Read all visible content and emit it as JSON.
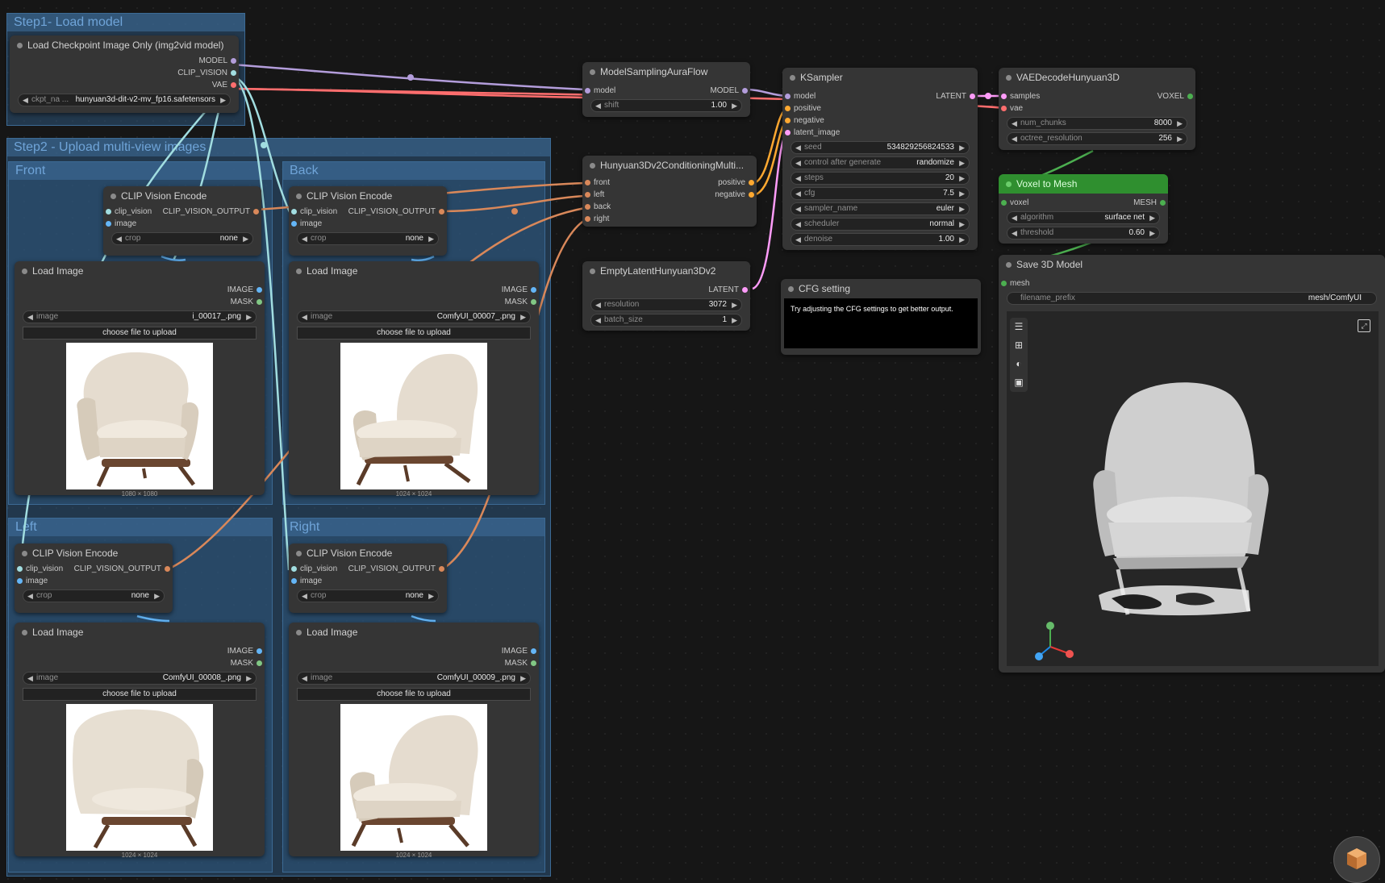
{
  "groups": {
    "step1": "Step1- Load model",
    "step2": "Step2 - Upload multi-view images",
    "front": "Front",
    "back": "Back",
    "left": "Left",
    "right": "Right"
  },
  "checkpoint": {
    "title": "Load Checkpoint Image Only (img2vid model)",
    "out_model": "MODEL",
    "out_clip_vision": "CLIP_VISION",
    "out_vae": "VAE",
    "ckpt_label": "ckpt_na ...",
    "ckpt_value": "hunyuan3d-dit-v2-mv_fp16.safetensors"
  },
  "clip_encode": {
    "title": "CLIP Vision Encode",
    "in_clip_vision": "clip_vision",
    "in_image": "image",
    "output": "CLIP_VISION_OUTPUT",
    "crop_label": "crop",
    "crop_value": "none"
  },
  "load_image": {
    "title": "Load Image",
    "out_image": "IMAGE",
    "out_mask": "MASK",
    "image_label": "image",
    "upload_label": "choose file to upload",
    "front_file": "i_00017_.png",
    "front_dim": "1080 × 1080",
    "back_file": "ComfyUI_00007_.png",
    "back_dim": "1024 × 1024",
    "left_file": "ComfyUI_00008_.png",
    "left_dim": "1024 × 1024",
    "right_file": "ComfyUI_00009_.png",
    "right_dim": "1024 × 1024"
  },
  "aura": {
    "title": "ModelSamplingAuraFlow",
    "in_model": "model",
    "out_model": "MODEL",
    "shift_label": "shift",
    "shift_value": "1.00"
  },
  "cond": {
    "title": "Hunyuan3Dv2ConditioningMulti...",
    "in_front": "front",
    "in_left": "left",
    "in_back": "back",
    "in_right": "right",
    "out_positive": "positive",
    "out_negative": "negative"
  },
  "latent": {
    "title": "EmptyLatentHunyuan3Dv2",
    "output": "LATENT",
    "resolution_label": "resolution",
    "resolution_value": "3072",
    "batch_label": "batch_size",
    "batch_value": "1"
  },
  "ksampler": {
    "title": "KSampler",
    "in_model": "model",
    "in_positive": "positive",
    "in_negative": "negative",
    "in_latent": "latent_image",
    "output": "LATENT",
    "widgets": [
      {
        "name": "seed",
        "value": "534829256824533"
      },
      {
        "name": "control after generate",
        "value": "randomize"
      },
      {
        "name": "steps",
        "value": "20"
      },
      {
        "name": "cfg",
        "value": "7.5"
      },
      {
        "name": "sampler_name",
        "value": "euler"
      },
      {
        "name": "scheduler",
        "value": "normal"
      },
      {
        "name": "denoise",
        "value": "1.00"
      }
    ]
  },
  "note": {
    "title": "CFG setting",
    "text": "Try adjusting the CFG settings to get better output."
  },
  "vae": {
    "title": "VAEDecodeHunyuan3D",
    "in_samples": "samples",
    "in_vae": "vae",
    "output": "VOXEL",
    "chunks_label": "num_chunks",
    "chunks_value": "8000",
    "octree_label": "octree_resolution",
    "octree_value": "256"
  },
  "voxel": {
    "title": "Voxel to Mesh",
    "in_voxel": "voxel",
    "output": "MESH",
    "algorithm_label": "algorithm",
    "algorithm_value": "surface net",
    "threshold_label": "threshold",
    "threshold_value": "0.60"
  },
  "save3d": {
    "title": "Save 3D Model",
    "in_mesh": "mesh",
    "prefix_label": "filename_prefix",
    "prefix_value": "mesh/ComfyUI"
  },
  "viewer_icons": [
    "menu-icon",
    "grid-icon",
    "palette-icon",
    "image-icon",
    "expand-icon"
  ],
  "colors": {
    "model": "#b39ddb",
    "clip_vision": "#a1dde0",
    "vae": "#ff6e6e",
    "clip_output": "#d9885a",
    "image": "#64b5f6",
    "mask": "#81c784",
    "conditioning": "#ffa931",
    "latent": "#ff9cf9",
    "voxel_mesh": "#4caf50"
  }
}
